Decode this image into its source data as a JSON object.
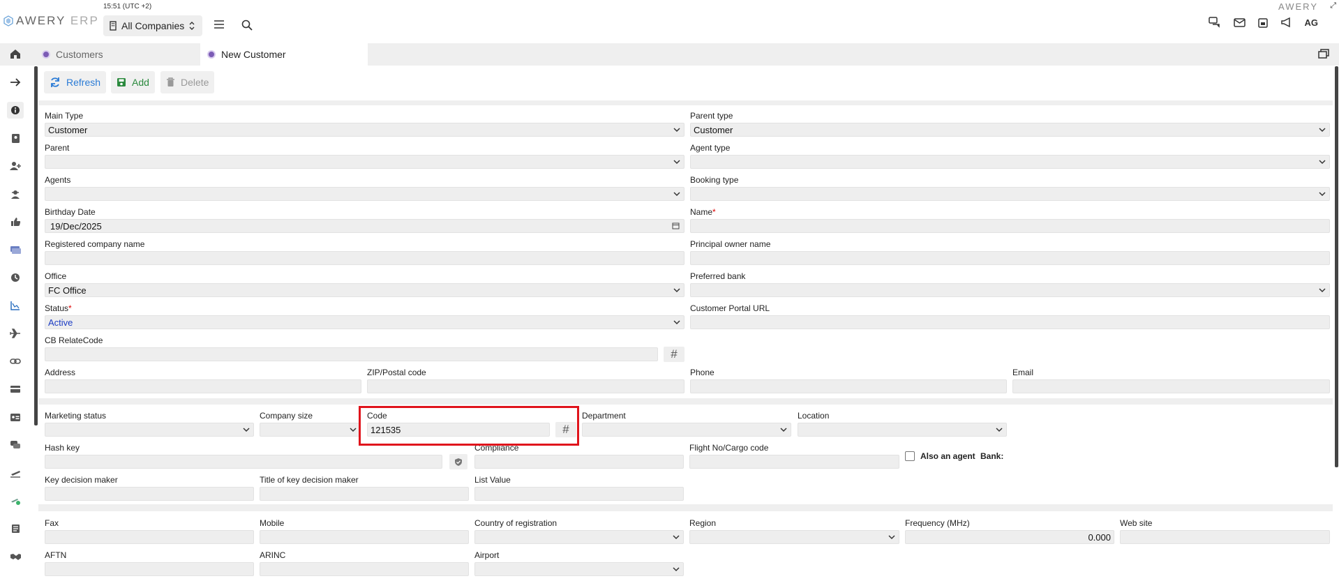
{
  "app": {
    "logo_main": "AWERY ",
    "logo_erp": "ERP",
    "brand_right": "AWERY",
    "clock": "15:51 (UTC +2)",
    "company": "All Companies",
    "avatar": "AG"
  },
  "tabs": [
    {
      "label": "Customers"
    },
    {
      "label": "New Customer"
    }
  ],
  "toolbar": {
    "refresh": "Refresh",
    "add": "Add",
    "delete": "Delete"
  },
  "form": {
    "main_type": {
      "label": "Main Type",
      "value": "Customer"
    },
    "parent_type": {
      "label": "Parent type",
      "value": "Customer"
    },
    "parent": {
      "label": "Parent",
      "value": ""
    },
    "agent_type": {
      "label": "Agent type",
      "value": ""
    },
    "agents": {
      "label": "Agents",
      "value": ""
    },
    "booking_type": {
      "label": "Booking type",
      "value": ""
    },
    "birthday": {
      "label": "Birthday Date",
      "value": "19/Dec/2025"
    },
    "name": {
      "label": "Name",
      "value": ""
    },
    "registered_company": {
      "label": "Registered company name",
      "value": ""
    },
    "principal_owner": {
      "label": "Principal owner name",
      "value": ""
    },
    "office": {
      "label": "Office",
      "value": "FC Office"
    },
    "preferred_bank": {
      "label": "Preferred bank",
      "value": ""
    },
    "status": {
      "label": "Status",
      "value": "Active"
    },
    "portal_url": {
      "label": "Customer Portal URL",
      "value": ""
    },
    "cb_relate": {
      "label": "CB RelateCode",
      "value": ""
    },
    "address": {
      "label": "Address",
      "value": ""
    },
    "zip": {
      "label": "ZIP/Postal code",
      "value": ""
    },
    "phone": {
      "label": "Phone",
      "value": ""
    },
    "email": {
      "label": "Email",
      "value": ""
    },
    "marketing_status": {
      "label": "Marketing status",
      "value": ""
    },
    "company_size": {
      "label": "Company size",
      "value": ""
    },
    "code": {
      "label": "Code",
      "value": "121535"
    },
    "department": {
      "label": "Department",
      "value": ""
    },
    "location": {
      "label": "Location",
      "value": ""
    },
    "hash_key": {
      "label": "Hash key",
      "value": ""
    },
    "compliance": {
      "label": "Compliance",
      "value": ""
    },
    "flight_no": {
      "label": "Flight No/Cargo code",
      "value": ""
    },
    "also_agent": {
      "label": "Also an agent"
    },
    "bank": {
      "label": "Bank:"
    },
    "key_decision": {
      "label": "Key decision maker",
      "value": ""
    },
    "title_key": {
      "label": "Title of key decision maker",
      "value": ""
    },
    "list_value": {
      "label": "List Value",
      "value": ""
    },
    "fax": {
      "label": "Fax",
      "value": ""
    },
    "mobile": {
      "label": "Mobile",
      "value": ""
    },
    "country": {
      "label": "Country of registration",
      "value": ""
    },
    "region": {
      "label": "Region",
      "value": ""
    },
    "frequency": {
      "label": "Frequency (MHz)",
      "value": "0.000"
    },
    "website": {
      "label": "Web site",
      "value": ""
    },
    "aftn": {
      "label": "AFTN",
      "value": ""
    },
    "arinc": {
      "label": "ARINC",
      "value": ""
    },
    "airport": {
      "label": "Airport",
      "value": ""
    }
  }
}
